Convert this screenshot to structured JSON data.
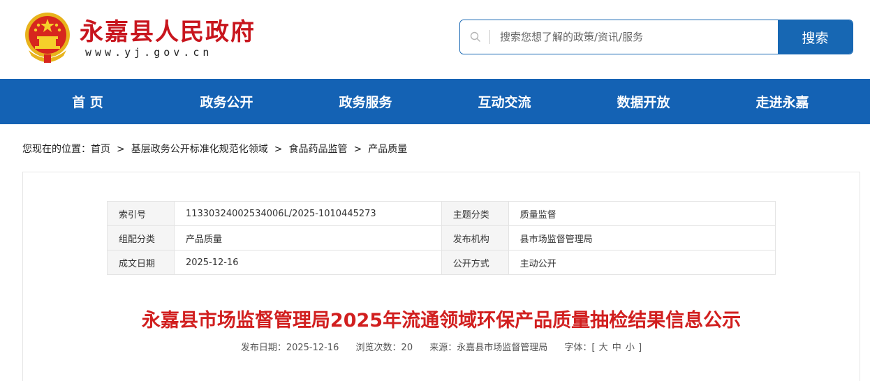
{
  "header": {
    "site_name": "永嘉县人民政府",
    "site_domain": "www.yj.gov.cn",
    "search": {
      "placeholder": "搜索您想了解的政策/资讯/服务",
      "button_label": "搜索"
    }
  },
  "nav": {
    "items": [
      "首 页",
      "政务公开",
      "政务服务",
      "互动交流",
      "数据开放",
      "走进永嘉"
    ]
  },
  "breadcrumb": {
    "prefix": "您现在的位置：",
    "items": [
      "首页",
      "基层政务公开标准化规范化领域",
      "食品药品监管",
      "产品质量"
    ],
    "separator": ">"
  },
  "meta_table": {
    "rows": [
      [
        "索引号",
        "11330324002534006L/2025-1010445273",
        "主题分类",
        "质量监督"
      ],
      [
        "组配分类",
        "产品质量",
        "发布机构",
        "县市场监督管理局"
      ],
      [
        "成文日期",
        "2025-12-16",
        "公开方式",
        "主动公开"
      ]
    ]
  },
  "article": {
    "title": "永嘉县市场监督管理局2025年流通领域环保产品质量抽检结果信息公示",
    "publish_date": "发布日期：2025-12-16",
    "views": "浏览次数：20",
    "source": "来源：永嘉县市场监督管理局",
    "font_label": "字体：[",
    "font_sizes": [
      "大",
      "中",
      "小"
    ],
    "font_close": "]"
  },
  "colors": {
    "brand_red": "#c8151d",
    "nav_blue": "#1462b4",
    "title_red": "#d11f1f"
  }
}
